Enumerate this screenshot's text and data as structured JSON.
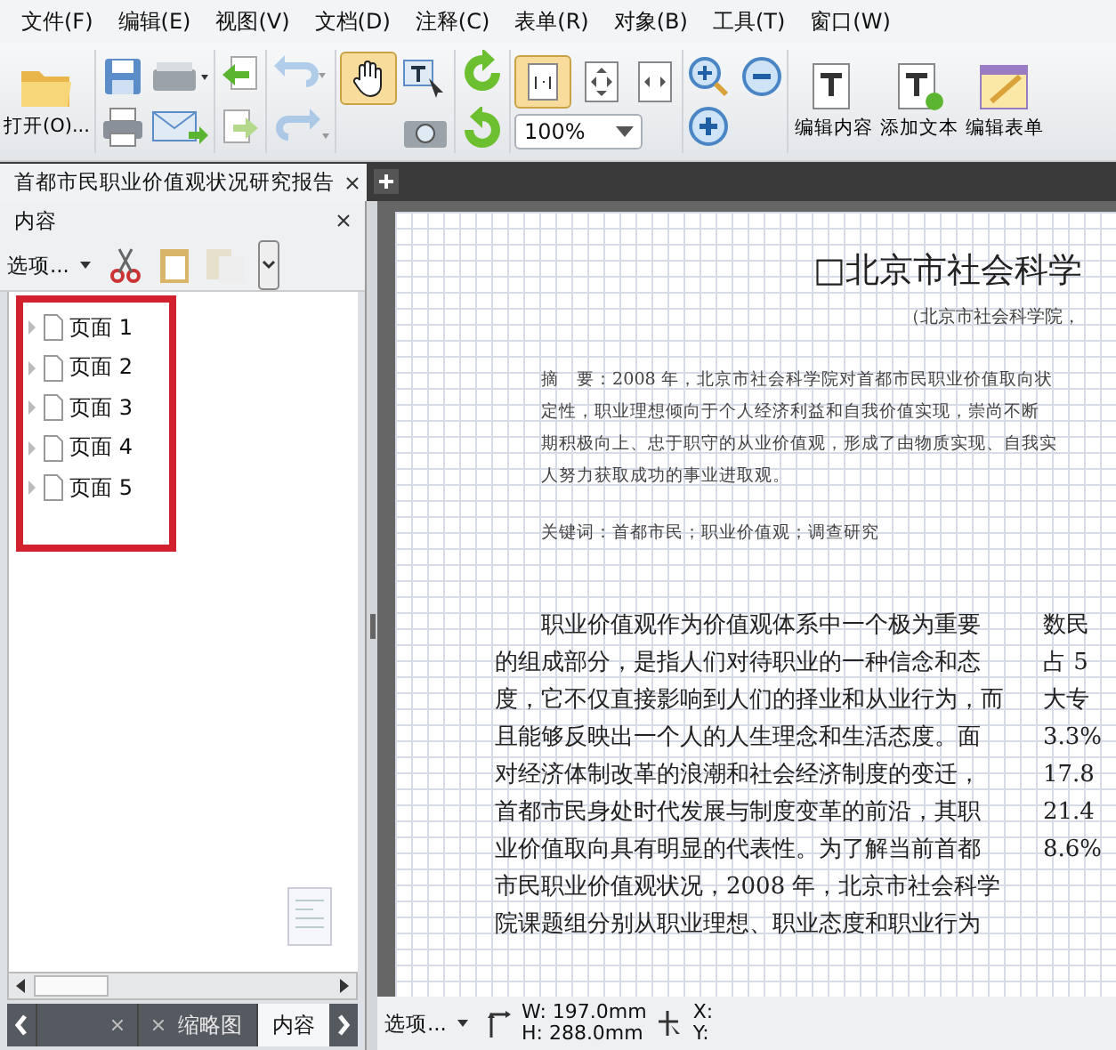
{
  "menu": [
    "文件(F)",
    "编辑(E)",
    "视图(V)",
    "文档(D)",
    "注释(C)",
    "表单(R)",
    "对象(B)",
    "工具(T)",
    "窗口(W)"
  ],
  "toolbar": {
    "open_label": "打开(O)...",
    "zoom": "100%",
    "hand_tool_selected": true,
    "actual_size_selected": true,
    "history_disabled": true,
    "actions": [
      "编辑内容",
      "添加文本",
      "编辑表单"
    ]
  },
  "doc_tabs": [
    {
      "label": "首都市民职业价值观状况研究报告",
      "selected": true
    }
  ],
  "panel": {
    "title": "内容",
    "options": "选项...",
    "pages": [
      "页面 1",
      "页面 2",
      "页面 3",
      "页面 4",
      "页面 5"
    ],
    "tabs": [
      {
        "label": "缩略图",
        "selected": false
      },
      {
        "label": "内容",
        "selected": true
      }
    ]
  },
  "document": {
    "title": "□北京市社会科学",
    "subtitle": "（北京市社会科学院，",
    "abstract": [
      "摘　要：2008 年，北京市社会科学院对首都市民职业价值取向状",
      "定性，职业理想倾向于个人经济利益和自我价值实现，崇尚不断",
      "期积极向上、忠于职守的从业价值观，形成了由物质实现、自我实",
      "人努力获取成功的事业进取观。"
    ],
    "keywords": "关键词：首都市民；职业价值观；调查研究",
    "body": [
      "职业价值观作为价值观体系中一个极为重要",
      "的组成部分，是指人们对待职业的一种信念和态",
      "度，它不仅直接影响到人们的择业和从业行为，而",
      "且能够反映出一个人的人生理念和生活态度。面",
      "对经济体制改革的浪潮和社会经济制度的变迁，",
      "首都市民身处时代发展与制度变革的前沿，其职",
      "业价值取向具有明显的代表性。为了解当前首都",
      "市民职业价值观状况，2008 年，北京市社会科学",
      "院课题组分别从职业理想、职业态度和职业行为"
    ],
    "column_2": [
      "数民",
      "占 5",
      "大专",
      "3.3%",
      "17.8",
      "21.4",
      "8.6%"
    ]
  },
  "status_bar": {
    "options": "选项...",
    "width": "W: 197.0mm",
    "height": "H: 288.0mm",
    "x": "X:",
    "y": "Y:"
  }
}
